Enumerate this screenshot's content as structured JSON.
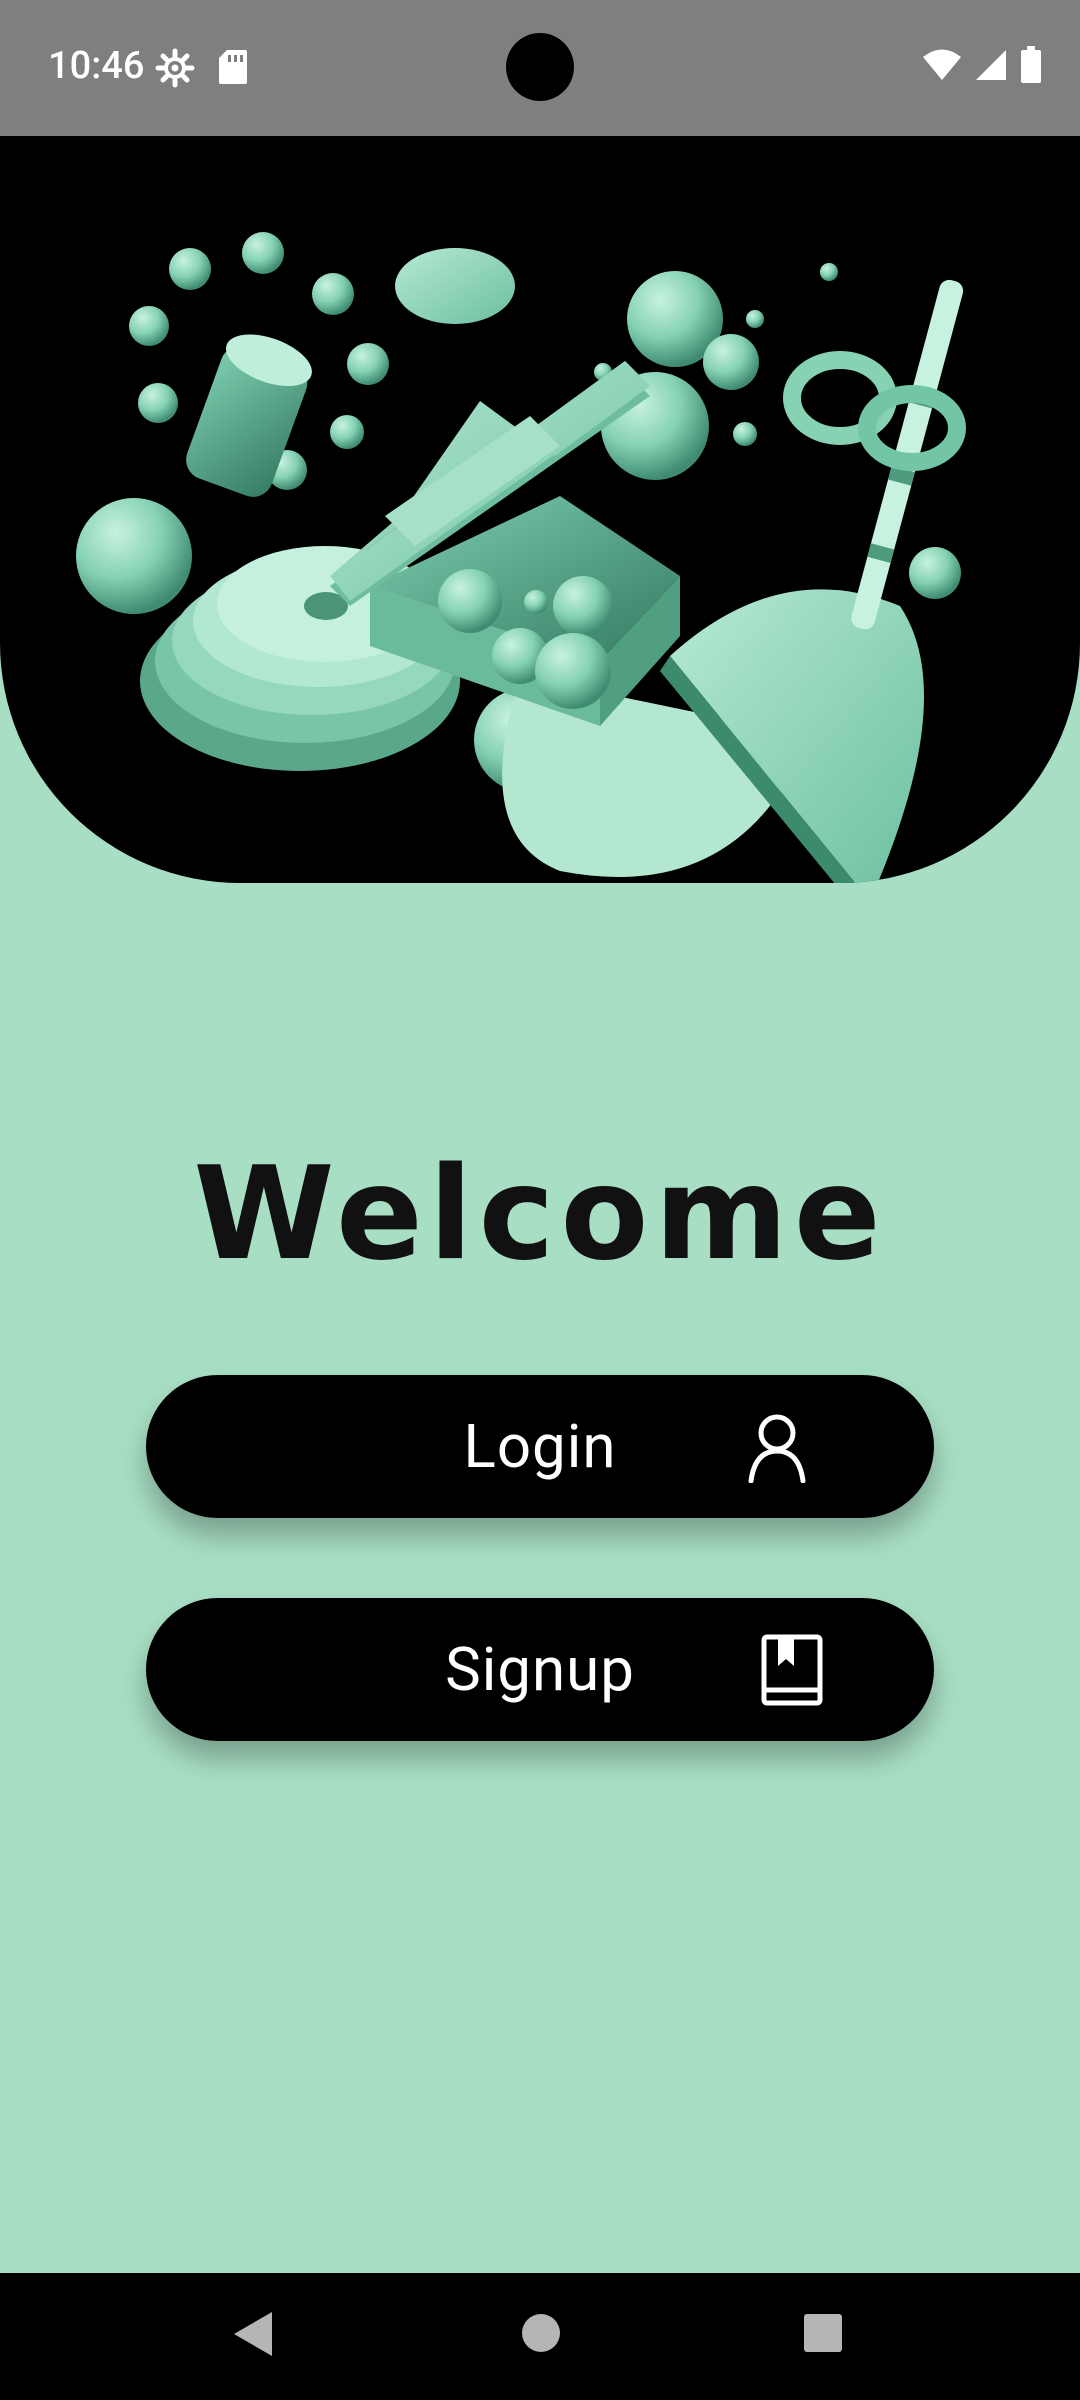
{
  "status_bar": {
    "time": "10:46",
    "left_icons": [
      "settings-gear-icon",
      "sd-card-icon"
    ],
    "right_icons": [
      "wifi-icon",
      "cell-signal-icon",
      "battery-icon"
    ]
  },
  "hero": {
    "image": "mint-abstract-3d-shapes-illustration",
    "colors": {
      "background": "#000000",
      "shapes": "#8fd6b9"
    }
  },
  "welcome": {
    "title": "Welcome"
  },
  "buttons": {
    "login": {
      "label": "Login",
      "icon": "person-icon"
    },
    "signup": {
      "label": "Signup",
      "icon": "book-icon"
    }
  },
  "navigation": {
    "buttons": [
      "back-icon",
      "home-icon",
      "recents-icon"
    ]
  },
  "theme": {
    "background": "#a8dfc4",
    "button": "#000000",
    "button_text": "#ffffff"
  }
}
